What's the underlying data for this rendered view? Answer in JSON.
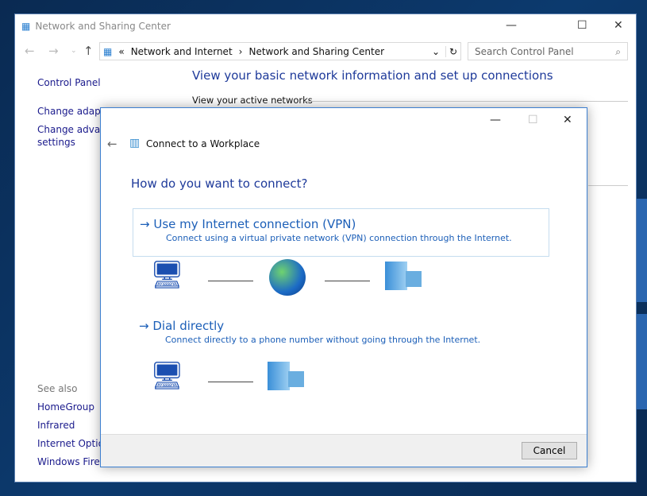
{
  "window": {
    "title": "Network and Sharing Center",
    "search_placeholder": "Search Control Panel",
    "breadcrumb": [
      "Network and Internet",
      "Network and Sharing Center"
    ],
    "heading": "View your basic network information and set up connections",
    "active_networks": "View your active networks",
    "sidebar": [
      "Control Panel Home",
      "Change adapter settings",
      "Change advanced sharing",
      "settings"
    ],
    "see_also": "See also",
    "see_also_items": [
      "HomeGroup",
      "Infrared",
      "Internet Options",
      "Windows Firewall"
    ]
  },
  "dialog": {
    "title": "Connect to a Workplace",
    "question": "How do you want to connect?",
    "options": [
      {
        "title": "Use my Internet connection (VPN)",
        "desc": "Connect using a virtual private network (VPN) connection through the Internet."
      },
      {
        "title": "Dial directly",
        "desc": "Connect directly to a phone number without going through the Internet."
      }
    ],
    "cancel": "Cancel"
  }
}
